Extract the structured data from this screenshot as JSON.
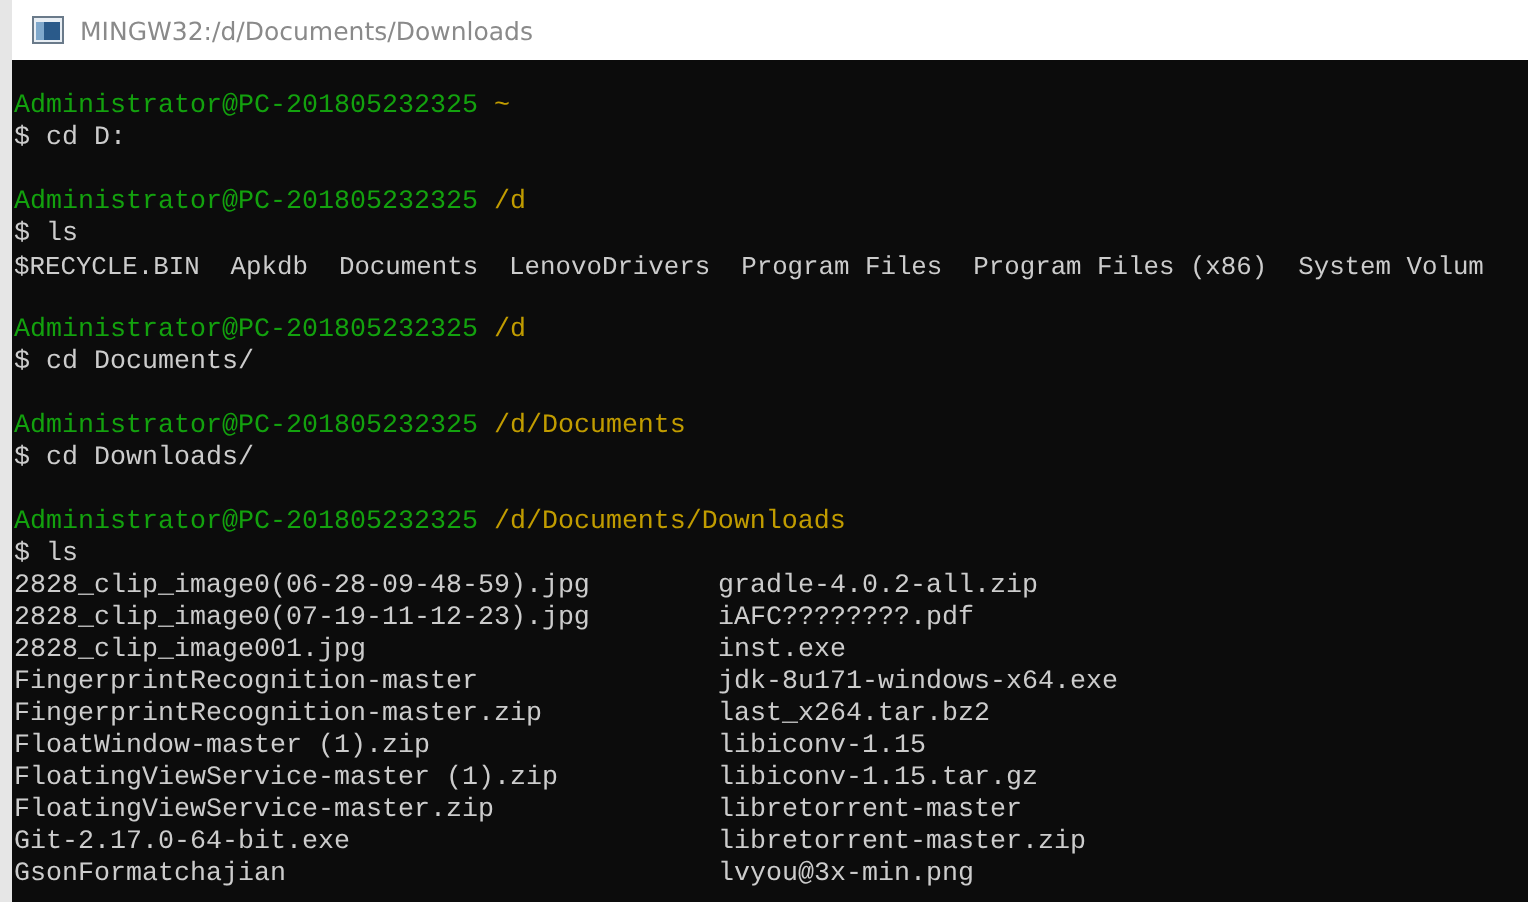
{
  "window": {
    "title": "MINGW32:/d/Documents/Downloads"
  },
  "terminal": {
    "lines": [
      {
        "kind": "blank"
      },
      {
        "kind": "prompt",
        "user": "Administrator@PC-201805232325",
        "path": "~"
      },
      {
        "kind": "command",
        "text": "$ cd D:"
      },
      {
        "kind": "blank"
      },
      {
        "kind": "prompt",
        "user": "Administrator@PC-201805232325",
        "path": "/d"
      },
      {
        "kind": "command",
        "text": "$ ls"
      },
      {
        "kind": "listing",
        "items": [
          "$RECYCLE.BIN",
          "Apkdb",
          "Documents",
          "LenovoDrivers",
          "Program Files",
          "Program Files (x86)",
          "System Volum"
        ]
      },
      {
        "kind": "blank"
      },
      {
        "kind": "prompt",
        "user": "Administrator@PC-201805232325",
        "path": "/d"
      },
      {
        "kind": "command",
        "text": "$ cd Documents/"
      },
      {
        "kind": "blank"
      },
      {
        "kind": "prompt",
        "user": "Administrator@PC-201805232325",
        "path": "/d/Documents"
      },
      {
        "kind": "command",
        "text": "$ cd Downloads/"
      },
      {
        "kind": "blank"
      },
      {
        "kind": "prompt",
        "user": "Administrator@PC-201805232325",
        "path": "/d/Documents/Downloads"
      },
      {
        "kind": "command",
        "text": "$ ls"
      },
      {
        "kind": "columns",
        "rows": [
          [
            "2828_clip_image0(06-28-09-48-59).jpg",
            "gradle-4.0.2-all.zip"
          ],
          [
            "2828_clip_image0(07-19-11-12-23).jpg",
            "iAFC????????.pdf"
          ],
          [
            "2828_clip_image001.jpg",
            "inst.exe"
          ],
          [
            "FingerprintRecognition-master",
            "jdk-8u171-windows-x64.exe"
          ],
          [
            "FingerprintRecognition-master.zip",
            "last_x264.tar.bz2"
          ],
          [
            "FloatWindow-master (1).zip",
            "libiconv-1.15"
          ],
          [
            "FloatingViewService-master (1).zip",
            "libiconv-1.15.tar.gz"
          ],
          [
            "FloatingViewService-master.zip",
            "libretorrent-master"
          ],
          [
            "Git-2.17.0-64-bit.exe",
            "libretorrent-master.zip"
          ],
          [
            "GsonFormatchajian",
            "lvyou@3x-min.png"
          ]
        ]
      }
    ]
  }
}
